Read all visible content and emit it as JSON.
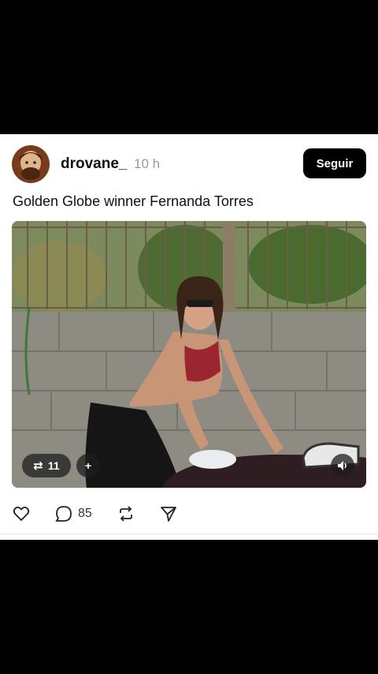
{
  "post": {
    "username": "drovane_",
    "time": "10 h",
    "follow_label": "Seguir",
    "caption": "Golden Globe winner Fernanda Torres"
  },
  "media": {
    "repost_count": "11",
    "add_label": "+"
  },
  "actions": {
    "comment_count": "85"
  }
}
